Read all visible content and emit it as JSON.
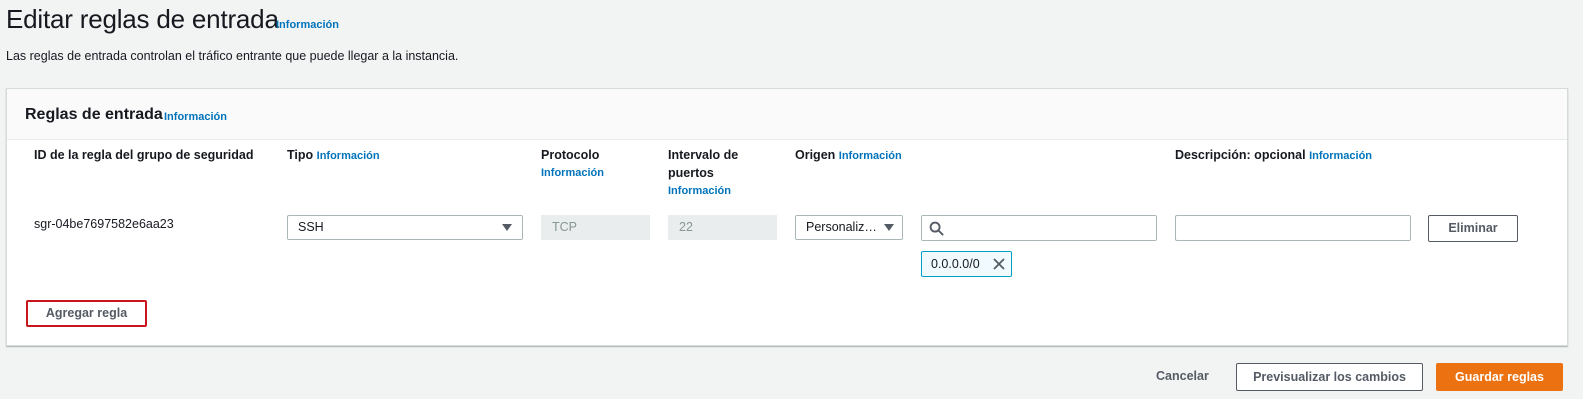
{
  "page": {
    "title": "Editar reglas de entrada",
    "title_info": "Información",
    "description": "Las reglas de entrada controlan el tráfico entrante que puede llegar a la instancia."
  },
  "panel": {
    "title": "Reglas de entrada",
    "title_info": "Información"
  },
  "columns": {
    "rule_id": "ID de la regla del grupo de seguridad",
    "type": "Tipo",
    "type_info": "Información",
    "protocol": "Protocolo",
    "protocol_info": "Información",
    "port_range_line1": "Intervalo de",
    "port_range_line2": "puertos",
    "port_range_info": "Información",
    "source": "Origen",
    "source_info": "Información",
    "description": "Descripción: opcional",
    "description_info": "Información"
  },
  "rule": {
    "id": "sgr-04be7697582e6aa23",
    "type": "SSH",
    "protocol": "TCP",
    "port_range": "22",
    "source_type": "Personaliz…",
    "search_value": "",
    "cidr": "0.0.0.0/0",
    "description_value": "",
    "delete_label": "Eliminar"
  },
  "add_rule_label": "Agregar regla",
  "footer": {
    "cancel_label": "Cancelar",
    "preview_label": "Previsualizar los cambios",
    "save_label": "Guardar reglas"
  },
  "colors": {
    "link": "#0073bb",
    "primary": "#ec7211",
    "highlight_border": "#c7161d",
    "token_border": "#00a1c9"
  },
  "icons": [
    "search-icon",
    "close-icon",
    "caret-down-icon"
  ]
}
